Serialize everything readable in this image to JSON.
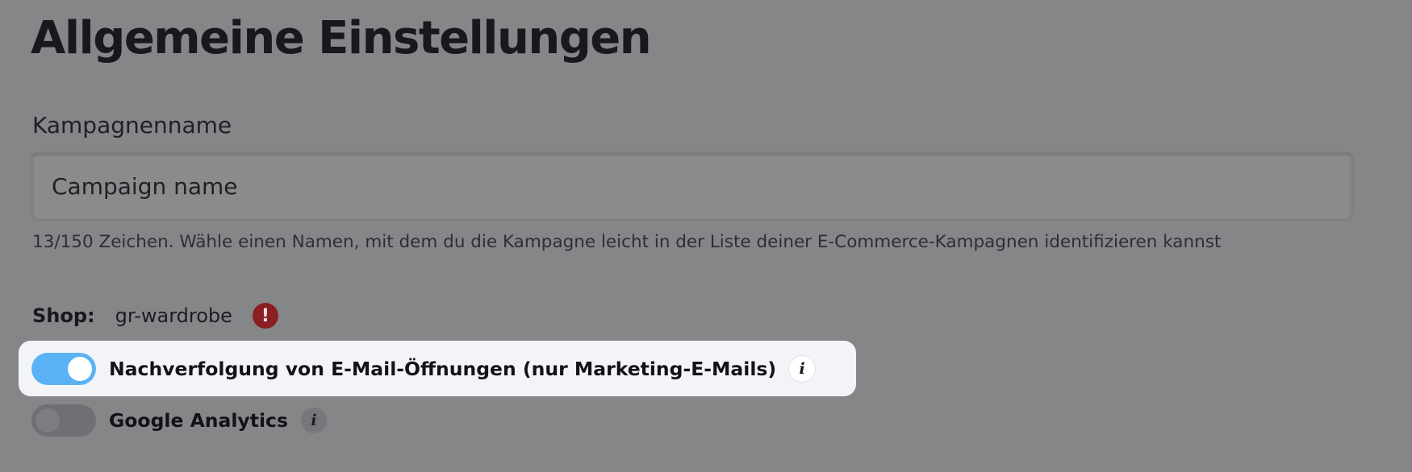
{
  "page": {
    "title": "Allgemeine Einstellungen"
  },
  "campaign_name": {
    "label": "Kampagnenname",
    "value": "Campaign name",
    "helper": "13/150 Zeichen. Wähle einen Namen, mit dem du die Kampagne leicht in der Liste deiner E-Commerce-Kampagnen identifizieren kannst"
  },
  "shop": {
    "label": "Shop:",
    "value": "gr-wardrobe",
    "warning_glyph": "!",
    "warning_icon": "exclamation-circle-icon",
    "warning_color": "#8b1e22"
  },
  "toggles": [
    {
      "label": "Nachverfolgung von E-Mail-Öffnungen (nur Marketing-E-Mails)",
      "enabled": true,
      "info_glyph": "i",
      "info_icon": "info-icon"
    },
    {
      "label": "Google Analytics",
      "enabled": false,
      "info_glyph": "i",
      "info_icon": "info-icon"
    }
  ],
  "colors": {
    "toggle_on": "#5ab2f4",
    "highlight_background": "#f3f4f8",
    "overlay_background": "#858688"
  }
}
